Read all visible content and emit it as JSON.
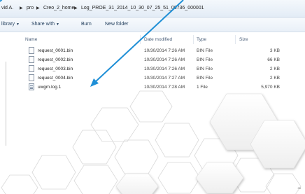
{
  "address": {
    "crumbs": [
      "vid A.",
      "pro",
      "Creo_2_home",
      "Log_PROE_31_2014_10_30_07_25_51_06736_000001"
    ]
  },
  "toolbar": {
    "library_label": "library",
    "share_label": "Share with",
    "burn_label": "Burn",
    "new_folder_label": "New folder"
  },
  "columns": {
    "name": "Name",
    "date": "Date modified",
    "type": "Type",
    "size": "Size"
  },
  "files": [
    {
      "name": "request_0001.bin",
      "date": "10/30/2014 7:26 AM",
      "type": "BIN File",
      "size": "3 KB",
      "icon": "file-icon"
    },
    {
      "name": "request_0002.bin",
      "date": "10/30/2014 7:26 AM",
      "type": "BIN File",
      "size": "66 KB",
      "icon": "file-icon"
    },
    {
      "name": "request_0003.bin",
      "date": "10/30/2014 7:26 AM",
      "type": "BIN File",
      "size": "2 KB",
      "icon": "file-icon"
    },
    {
      "name": "request_0004.bin",
      "date": "10/30/2014 7:27 AM",
      "type": "BIN File",
      "size": "2 KB",
      "icon": "file-icon"
    },
    {
      "name": "uwgm.log.1",
      "date": "10/30/2014 7:28 AM",
      "type": "1 File",
      "size": "5,970 KB",
      "icon": "log-file-icon"
    }
  ],
  "annotation": {
    "arrow_color": "#1f8fd6",
    "arrow_points_to": "uwgm.log.1"
  },
  "slide": {
    "page_number": "28"
  }
}
